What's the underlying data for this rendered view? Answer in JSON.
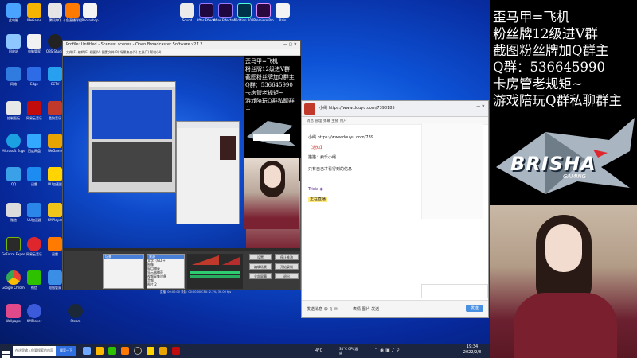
{
  "desktop": {
    "icons_col1": [
      "此电脑",
      "回收站",
      "网络",
      "控制面板",
      "微信",
      "QQ",
      "Microsoft Edge",
      "Google Chrome",
      "Steam",
      "GeForce Experience",
      "腾讯QQ",
      "Wallpaper",
      "酷狗音乐"
    ],
    "icons_col2": [
      "WeGame",
      "电脑管家",
      "Edge",
      "百度网盘",
      "迅雷",
      "OBS Studio",
      "UU加速器",
      "网易云音乐",
      "CCTV",
      "KMPlayer"
    ],
    "top_icons": [
      "斗鱼直播伴侣",
      "Photoshop",
      "Sound",
      "After Effects",
      "After Effects 2022",
      "Audition 2022",
      "Premiere Pro",
      "Rain"
    ]
  },
  "obs": {
    "title": "Profile: Untitled - Scenes: scenes - Open Broadcaster Software v27.2",
    "menu": "文件(F)  编辑(E)  视图(V)  配置文件(P)  场景集合(S)  工具(T)  帮助(H)",
    "scenes_header": "场景",
    "sources_header": "来源",
    "sources": [
      "文字（GDI+）",
      "图像",
      "窗口捕获",
      "显示器捕获",
      "视频采集设备",
      "音频",
      "图片 2",
      "游戏"
    ],
    "buttons": [
      "开始推流",
      "停止录制",
      "工作室模式",
      "设置",
      "退出"
    ],
    "controls": [
      "设置",
      "停止推流",
      "编辑场景",
      "开始录制",
      "全部屏幕",
      "退出"
    ],
    "status": "直播: 00:00:00   录制: 00:00:00   CPU: 2.1%, 30.00 fps"
  },
  "chat": {
    "url": "小绳 https://www.douyu.com/7398185",
    "tabs": "消息  管理  弹幕  主播  用户",
    "messages": [
      "小绳  https://www.douyu.com/739...",
      "【通知】",
      "猫猫：卖乐小绳",
      "只有自己才看得到的信息",
      "Tricia  ◉",
      "正在直播"
    ],
    "footer_left": "发送消息  ☺  ♫  ✉",
    "footer_right": "表情  图片  发送",
    "send": "发送"
  },
  "overlay": {
    "lines": [
      "歪马甲=飞机",
      "粉丝牌12级进V群",
      "截图粉丝牌加Q群主",
      "Q群：536645990",
      "卡房管老规矩~",
      "游戏陪玩Q群私聊群主"
    ],
    "logo_text": "BRISHA",
    "logo_sub": "GAMING"
  },
  "mini_overlay": {
    "lines": [
      "歪马甲=飞机",
      "粉丝牌12级进V群",
      "截图粉丝牌加Q群主",
      "Q群：536645990",
      "卡房管老规矩~",
      "游戏陪玩Q群私聊群主"
    ]
  },
  "taskbar": {
    "search_placeholder": "在这里输入你要搜索的内容",
    "search_button": "搜索一下",
    "weather": "4°C",
    "cpu": "34°C CPU温度",
    "time": "19:34",
    "date": "2022/2/8"
  },
  "colors": {
    "desktop_blue": "#0d52d6",
    "overlay_bg": "#000000",
    "chat_accent": "#c0392b"
  }
}
